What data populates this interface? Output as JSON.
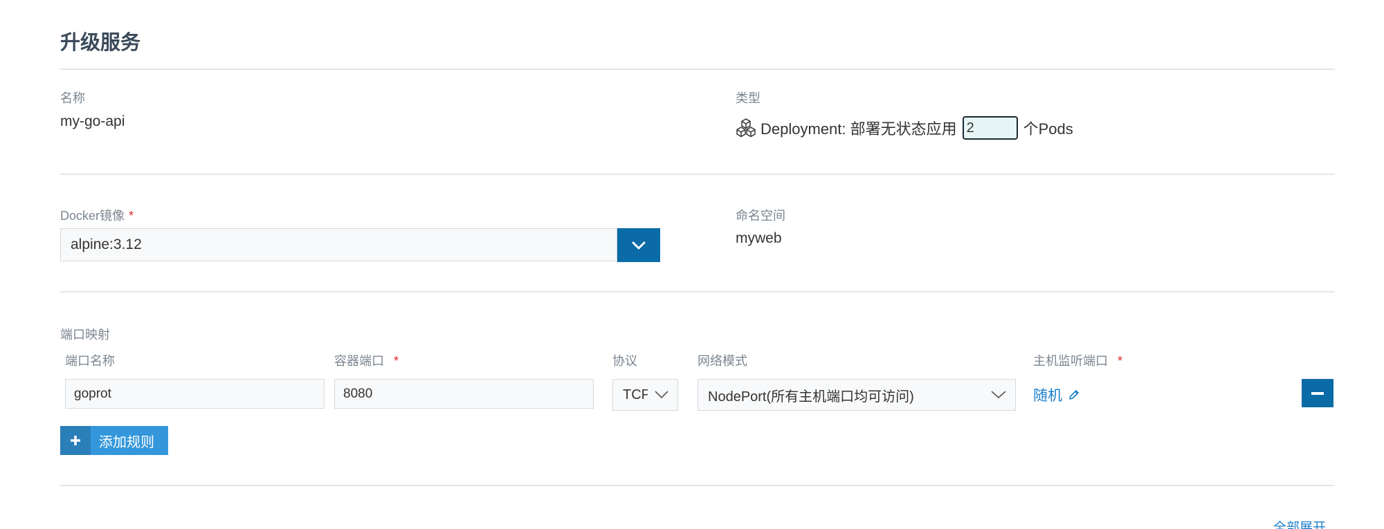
{
  "header": {
    "title": "升级服务"
  },
  "name_field": {
    "label": "名称",
    "value": "my-go-api"
  },
  "type_field": {
    "label": "类型",
    "icon": "cubes-icon",
    "prefix": "Deployment: 部署无状态应用",
    "pods_value": "2",
    "suffix": "个Pods"
  },
  "docker_image": {
    "label": "Docker镜像",
    "required": "*",
    "value": "alpine:3.12"
  },
  "namespace": {
    "label": "命名空间",
    "value": "myweb"
  },
  "port_mapping": {
    "section_label": "端口映射",
    "columns": {
      "port_name": "端口名称",
      "container_port": "容器端口",
      "protocol": "协议",
      "network_mode": "网络模式",
      "host_port": "主机监听端口",
      "required": "*"
    },
    "rows": [
      {
        "port_name": "goprot",
        "container_port": "8080",
        "protocol": "TCP",
        "network_mode": "NodePort(所有主机端口均可访问)",
        "host_port": "随机"
      }
    ],
    "add_rule_label": "添加规则"
  },
  "footer": {
    "expand_all_label": "全部展开"
  },
  "colors": {
    "primary_button": "#0a6ba6",
    "add_button": "#3497db",
    "link": "#1a7fc9",
    "required": "#e02424"
  }
}
